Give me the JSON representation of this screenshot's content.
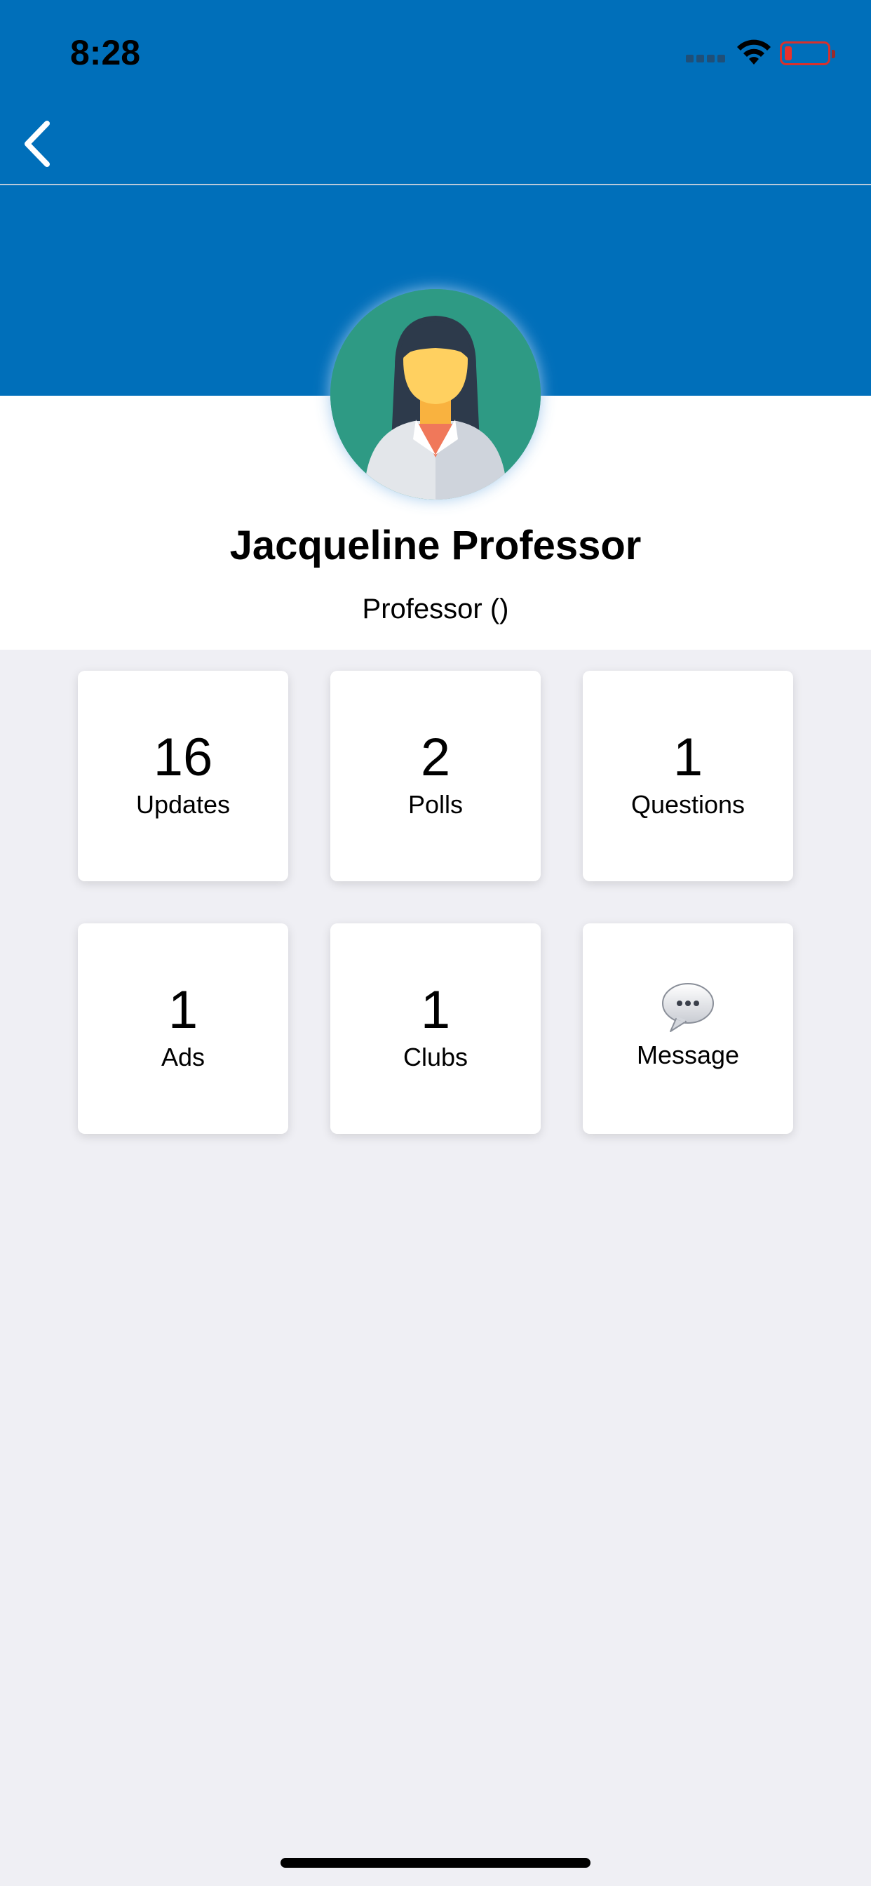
{
  "status_bar": {
    "time": "8:28"
  },
  "navbar": {
    "back_icon": "chevron-left-icon"
  },
  "profile": {
    "name": "Jacqueline Professor",
    "role": "Professor ()",
    "avatar_icon": "female-professor-avatar"
  },
  "tiles": [
    {
      "count": "16",
      "label": "Updates"
    },
    {
      "count": "2",
      "label": "Polls"
    },
    {
      "count": "1",
      "label": "Questions"
    },
    {
      "count": "1",
      "label": "Ads"
    },
    {
      "count": "1",
      "label": "Clubs"
    },
    {
      "label": "Message",
      "icon": "speech-bubble-icon"
    }
  ],
  "colors": {
    "brand_blue": "#006fba",
    "background": "#efeff4",
    "avatar_bg": "#2e9a84"
  }
}
